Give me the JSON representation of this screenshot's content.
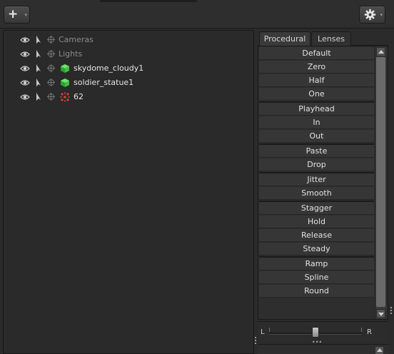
{
  "toolbar": {
    "add_icon": "plus-icon",
    "gear_icon": "gear-icon",
    "dropdown_arrow": "▾"
  },
  "outliner": {
    "items": [
      {
        "label": "Cameras",
        "type": "group",
        "icon": "crosshair-icon"
      },
      {
        "label": "Lights",
        "type": "group",
        "icon": "crosshair-icon"
      },
      {
        "label": "skydome_cloudy1",
        "type": "object",
        "icon": "green-cube-icon"
      },
      {
        "label": "soldier_statue1",
        "type": "object",
        "icon": "green-cube-icon"
      },
      {
        "label": "62",
        "type": "object",
        "icon": "red-particles-icon"
      }
    ]
  },
  "panel": {
    "tabs": [
      {
        "label": "Procedural",
        "active": true
      },
      {
        "label": "Lenses",
        "active": false
      }
    ],
    "groups": [
      [
        "Default",
        "Zero",
        "Half",
        "One"
      ],
      [
        "Playhead",
        "In",
        "Out"
      ],
      [
        "Paste",
        "Drop"
      ],
      [
        "Jitter",
        "Smooth"
      ],
      [
        "Stagger",
        "Hold",
        "Release",
        "Steady"
      ],
      [
        "Ramp",
        "Spline",
        "Round"
      ]
    ],
    "slider": {
      "left_label": "L",
      "right_label": "R",
      "position": 0.5,
      "grip": "•••"
    }
  },
  "colors": {
    "background": "#2b2b2b",
    "button": "#363636",
    "cube_green": "#3fbf3f",
    "particles_red": "#d04040"
  }
}
